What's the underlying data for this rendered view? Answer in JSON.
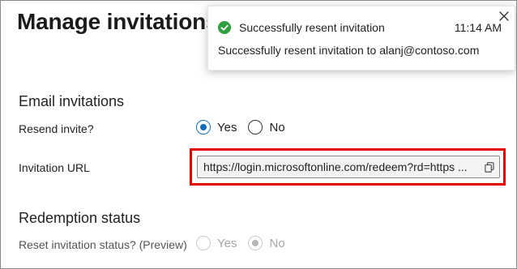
{
  "page": {
    "title": "Manage invitations"
  },
  "email_invitations": {
    "heading": "Email invitations",
    "resend_label": "Resend invite?",
    "resend_options": [
      "Yes",
      "No"
    ],
    "resend_selected": "Yes",
    "url_label": "Invitation URL",
    "url_value": "https://login.microsoftonline.com/redeem?rd=https ..."
  },
  "redemption_status": {
    "heading": "Redemption status",
    "reset_label": "Reset invitation status? (Preview)",
    "reset_options": [
      "Yes",
      "No"
    ],
    "reset_selected": "No",
    "reset_disabled": true
  },
  "toast": {
    "title": "Successfully resent invitation",
    "time": "11:14 AM",
    "message": "Successfully resent invitation to alanj@contoso.com",
    "icon": "success-check-icon",
    "close_icon": "close-icon"
  },
  "colors": {
    "accent": "#0f6cbd",
    "success": "#2e9e3e",
    "highlight": "#e00000"
  }
}
